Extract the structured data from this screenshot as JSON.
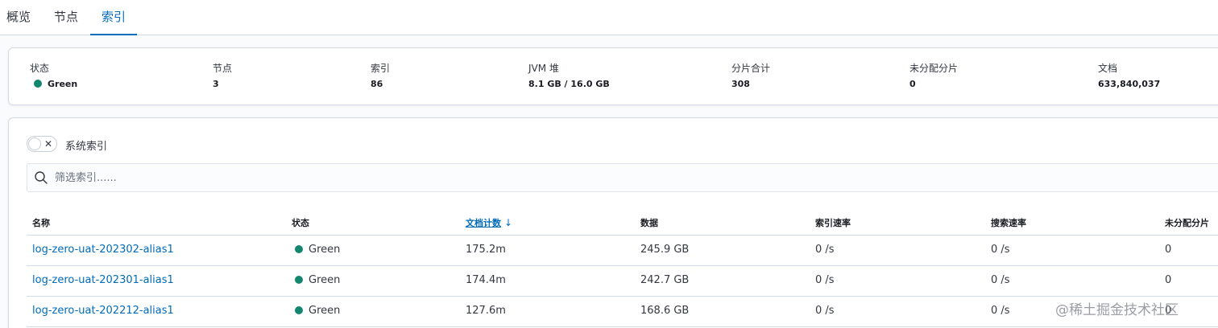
{
  "tabs": [
    "概览",
    "节点",
    "索引"
  ],
  "active_tab": 2,
  "colors": {
    "accent": "#006bb8",
    "status_green": "#12866f"
  },
  "stats": [
    {
      "label": "状态",
      "value": "Green",
      "status_dot": "green"
    },
    {
      "label": "节点",
      "value": "3"
    },
    {
      "label": "索引",
      "value": "86"
    },
    {
      "label": "JVM 堆",
      "value": "8.1 GB / 16.0 GB"
    },
    {
      "label": "分片合计",
      "value": "308"
    },
    {
      "label": "未分配分片",
      "value": "0"
    },
    {
      "label": "文档",
      "value": "633,840,037"
    }
  ],
  "system_index_toggle": {
    "label": "系统索引",
    "checked": false
  },
  "search": {
    "placeholder": "筛选索引......",
    "icon": "search-icon"
  },
  "table": {
    "columns": [
      "名称",
      "状态",
      "文档计数",
      "数据",
      "索引速率",
      "搜索速率",
      "未分配分片"
    ],
    "sorted_column": 2,
    "sort_direction": "desc",
    "rows": [
      [
        "log-zero-uat-202302-alias1",
        "Green",
        "175.2m",
        "245.9 GB",
        "0 /s",
        "0 /s",
        "0"
      ],
      [
        "log-zero-uat-202301-alias1",
        "Green",
        "174.4m",
        "242.7 GB",
        "0 /s",
        "0 /s",
        "0"
      ],
      [
        "log-zero-uat-202212-alias1",
        "Green",
        "127.6m",
        "168.6 GB",
        "0 /s",
        "0 /s",
        "0"
      ]
    ]
  },
  "watermark": "@稀土掘金技术社区"
}
